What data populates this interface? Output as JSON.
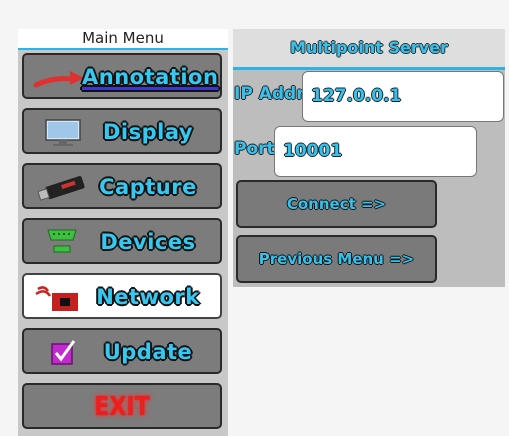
{
  "main_menu": {
    "title": "Main Menu",
    "items": [
      {
        "label": "Annotation",
        "icon": "red-arrow-icon"
      },
      {
        "label": "Display",
        "icon": "monitor-icon"
      },
      {
        "label": "Capture",
        "icon": "usb-stick-icon"
      },
      {
        "label": "Devices",
        "icon": "serial-port-icon"
      },
      {
        "label": "Network",
        "icon": "network-icon",
        "active": true
      },
      {
        "label": "Update",
        "icon": "checkbox-icon"
      },
      {
        "label": "EXIT"
      }
    ]
  },
  "server": {
    "title": "Multipoint Server",
    "ip_label": "IP Addr",
    "ip_value": "127.0.0.1",
    "port_label": "Port",
    "port_value": "10001",
    "connect_label": "Connect =>",
    "previous_label": "Previous Menu =>"
  },
  "colors": {
    "accent": "#36c0ec",
    "exit": "#e82020",
    "annotation_arrow": "#e03030"
  }
}
